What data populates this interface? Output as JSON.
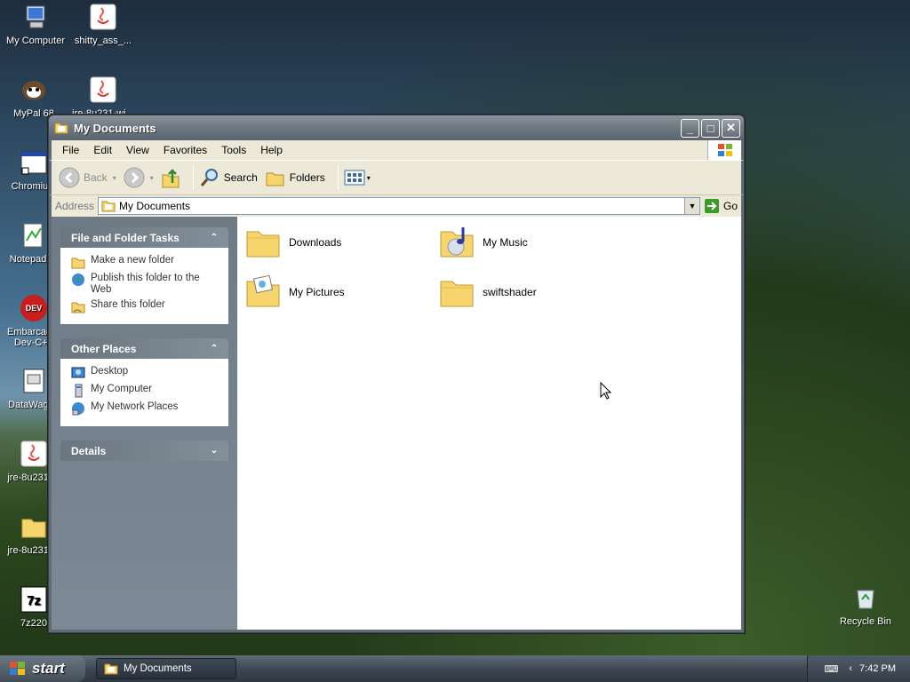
{
  "desktop": {
    "icons": [
      {
        "label": "My Computer",
        "icon": "my-computer-icon"
      },
      {
        "label": "shitty_ass_...",
        "icon": "java-icon"
      },
      {
        "label": "MyPal 68",
        "icon": "mypal-icon"
      },
      {
        "label": "jre-8u231-wi...",
        "icon": "java-icon"
      },
      {
        "label": "Chromium",
        "icon": "chromium-shortcut-icon"
      },
      {
        "label": "Notepad++",
        "icon": "notepad-plus-icon"
      },
      {
        "label": "Embarcadero Dev-C++",
        "icon": "devcpp-icon"
      },
      {
        "label": "DataWagon",
        "icon": "datawagon-icon"
      },
      {
        "label": "jre-8u231-...",
        "icon": "java-icon"
      },
      {
        "label": "jre-8u231-...",
        "icon": "folder-icon"
      },
      {
        "label": "7z220",
        "icon": "7zip-icon"
      },
      {
        "label": "Recycle Bin",
        "icon": "recycle-bin-icon"
      }
    ]
  },
  "window": {
    "title": "My Documents",
    "menu": [
      "File",
      "Edit",
      "View",
      "Favorites",
      "Tools",
      "Help"
    ],
    "toolbar": {
      "back": "Back",
      "search": "Search",
      "folders": "Folders"
    },
    "address": {
      "label": "Address",
      "value": "My Documents",
      "go": "Go"
    },
    "panels": {
      "file_tasks": {
        "title": "File and Folder Tasks",
        "items": [
          "Make a new folder",
          "Publish this folder to the Web",
          "Share this folder"
        ]
      },
      "other_places": {
        "title": "Other Places",
        "items": [
          "Desktop",
          "My Computer",
          "My Network Places"
        ]
      },
      "details": {
        "title": "Details"
      }
    },
    "items": [
      {
        "name": "Downloads",
        "icon": "folder-icon"
      },
      {
        "name": "My Music",
        "icon": "my-music-folder-icon"
      },
      {
        "name": "My Pictures",
        "icon": "my-pictures-folder-icon"
      },
      {
        "name": "swiftshader",
        "icon": "folder-icon"
      }
    ]
  },
  "taskbar": {
    "start": "start",
    "task": "My Documents",
    "clock": "7:42 PM"
  },
  "colors": {
    "folder_yellow": "#f7d56d",
    "go_green": "#3a9a2a",
    "panel_grey": "#7d8994"
  }
}
